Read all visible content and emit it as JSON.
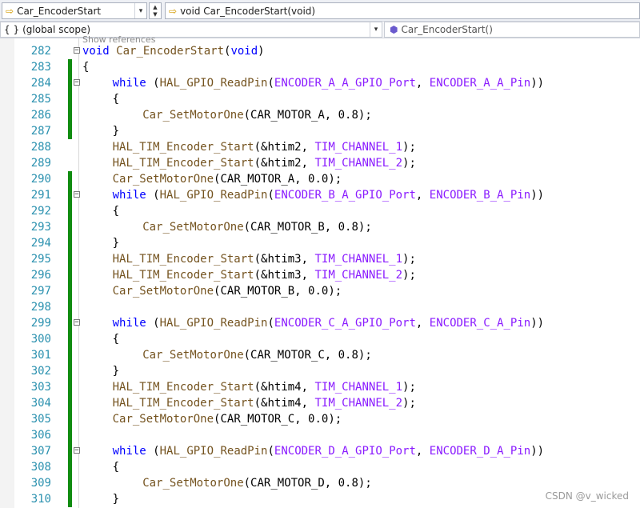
{
  "toolbar": {
    "project_combo": "Car_EncoderStart",
    "member_combo": "void Car_EncoderStart(void)",
    "scope_combo": "(global scope)",
    "scope_icon": "{ }",
    "symbol_combo": "Car_EncoderStart()",
    "spin_up": "▲",
    "spin_down": "▼",
    "dropdown_glyph": "▾"
  },
  "editor": {
    "codelens": "Show references",
    "watermark": "CSDN @v_wicked",
    "colors": {
      "keyword": "#0000ff",
      "function": "#74531f",
      "macro": "#8a1bff",
      "line_number": "#2b91af",
      "change_bar": "#108c10"
    },
    "lines": [
      {
        "num": "282",
        "fold": true,
        "changed": false,
        "indent": 0,
        "tokens": [
          [
            "k",
            "void"
          ],
          [
            "p",
            " "
          ],
          [
            "f",
            "Car_EncoderStart"
          ],
          [
            "p",
            "("
          ],
          [
            "k",
            "void"
          ],
          [
            "p",
            ")"
          ]
        ]
      },
      {
        "num": "283",
        "fold": false,
        "changed": true,
        "indent": 0,
        "tokens": [
          [
            "p",
            "{"
          ]
        ]
      },
      {
        "num": "284",
        "fold": true,
        "changed": true,
        "indent": 1,
        "tokens": [
          [
            "k",
            "while"
          ],
          [
            "p",
            " ("
          ],
          [
            "f",
            "HAL_GPIO_ReadPin"
          ],
          [
            "p",
            "("
          ],
          [
            "m",
            "ENCODER_A_A_GPIO_Port"
          ],
          [
            "p",
            ", "
          ],
          [
            "m",
            "ENCODER_A_A_Pin"
          ],
          [
            "p",
            "))"
          ]
        ]
      },
      {
        "num": "285",
        "fold": false,
        "changed": true,
        "indent": 1,
        "tokens": [
          [
            "p",
            "{"
          ]
        ]
      },
      {
        "num": "286",
        "fold": false,
        "changed": true,
        "indent": 2,
        "tokens": [
          [
            "f",
            "Car_SetMotorOne"
          ],
          [
            "p",
            "(CAR_MOTOR_A, 0.8);"
          ]
        ]
      },
      {
        "num": "287",
        "fold": false,
        "changed": true,
        "indent": 1,
        "tokens": [
          [
            "p",
            "}"
          ]
        ]
      },
      {
        "num": "288",
        "fold": false,
        "changed": false,
        "indent": 1,
        "tokens": [
          [
            "f",
            "HAL_TIM_Encoder_Start"
          ],
          [
            "p",
            "(&htim2, "
          ],
          [
            "m",
            "TIM_CHANNEL_1"
          ],
          [
            "p",
            ");"
          ]
        ]
      },
      {
        "num": "289",
        "fold": false,
        "changed": false,
        "indent": 1,
        "tokens": [
          [
            "f",
            "HAL_TIM_Encoder_Start"
          ],
          [
            "p",
            "(&htim2, "
          ],
          [
            "m",
            "TIM_CHANNEL_2"
          ],
          [
            "p",
            ");"
          ]
        ]
      },
      {
        "num": "290",
        "fold": false,
        "changed": true,
        "indent": 1,
        "tokens": [
          [
            "f",
            "Car_SetMotorOne"
          ],
          [
            "p",
            "(CAR_MOTOR_A, 0.0);"
          ]
        ]
      },
      {
        "num": "291",
        "fold": true,
        "changed": true,
        "indent": 1,
        "tokens": [
          [
            "k",
            "while"
          ],
          [
            "p",
            " ("
          ],
          [
            "f",
            "HAL_GPIO_ReadPin"
          ],
          [
            "p",
            "("
          ],
          [
            "m",
            "ENCODER_B_A_GPIO_Port"
          ],
          [
            "p",
            ", "
          ],
          [
            "m",
            "ENCODER_B_A_Pin"
          ],
          [
            "p",
            "))"
          ]
        ]
      },
      {
        "num": "292",
        "fold": false,
        "changed": true,
        "indent": 1,
        "tokens": [
          [
            "p",
            "{"
          ]
        ]
      },
      {
        "num": "293",
        "fold": false,
        "changed": true,
        "indent": 2,
        "tokens": [
          [
            "f",
            "Car_SetMotorOne"
          ],
          [
            "p",
            "(CAR_MOTOR_B, 0.8);"
          ]
        ]
      },
      {
        "num": "294",
        "fold": false,
        "changed": true,
        "indent": 1,
        "tokens": [
          [
            "p",
            "}"
          ]
        ]
      },
      {
        "num": "295",
        "fold": false,
        "changed": true,
        "indent": 1,
        "tokens": [
          [
            "f",
            "HAL_TIM_Encoder_Start"
          ],
          [
            "p",
            "(&htim3, "
          ],
          [
            "m",
            "TIM_CHANNEL_1"
          ],
          [
            "p",
            ");"
          ]
        ]
      },
      {
        "num": "296",
        "fold": false,
        "changed": true,
        "indent": 1,
        "tokens": [
          [
            "f",
            "HAL_TIM_Encoder_Start"
          ],
          [
            "p",
            "(&htim3, "
          ],
          [
            "m",
            "TIM_CHANNEL_2"
          ],
          [
            "p",
            ");"
          ]
        ]
      },
      {
        "num": "297",
        "fold": false,
        "changed": true,
        "indent": 1,
        "tokens": [
          [
            "f",
            "Car_SetMotorOne"
          ],
          [
            "p",
            "(CAR_MOTOR_B, 0.0);"
          ]
        ]
      },
      {
        "num": "298",
        "fold": false,
        "changed": true,
        "indent": 0,
        "tokens": []
      },
      {
        "num": "299",
        "fold": true,
        "changed": true,
        "indent": 1,
        "tokens": [
          [
            "k",
            "while"
          ],
          [
            "p",
            " ("
          ],
          [
            "f",
            "HAL_GPIO_ReadPin"
          ],
          [
            "p",
            "("
          ],
          [
            "m",
            "ENCODER_C_A_GPIO_Port"
          ],
          [
            "p",
            ", "
          ],
          [
            "m",
            "ENCODER_C_A_Pin"
          ],
          [
            "p",
            "))"
          ]
        ]
      },
      {
        "num": "300",
        "fold": false,
        "changed": true,
        "indent": 1,
        "tokens": [
          [
            "p",
            "{"
          ]
        ]
      },
      {
        "num": "301",
        "fold": false,
        "changed": true,
        "indent": 2,
        "tokens": [
          [
            "f",
            "Car_SetMotorOne"
          ],
          [
            "p",
            "(CAR_MOTOR_C, 0.8);"
          ]
        ]
      },
      {
        "num": "302",
        "fold": false,
        "changed": true,
        "indent": 1,
        "tokens": [
          [
            "p",
            "}"
          ]
        ]
      },
      {
        "num": "303",
        "fold": false,
        "changed": true,
        "indent": 1,
        "tokens": [
          [
            "f",
            "HAL_TIM_Encoder_Start"
          ],
          [
            "p",
            "(&htim4, "
          ],
          [
            "m",
            "TIM_CHANNEL_1"
          ],
          [
            "p",
            ");"
          ]
        ]
      },
      {
        "num": "304",
        "fold": false,
        "changed": true,
        "indent": 1,
        "tokens": [
          [
            "f",
            "HAL_TIM_Encoder_Start"
          ],
          [
            "p",
            "(&htim4, "
          ],
          [
            "m",
            "TIM_CHANNEL_2"
          ],
          [
            "p",
            ");"
          ]
        ]
      },
      {
        "num": "305",
        "fold": false,
        "changed": true,
        "indent": 1,
        "tokens": [
          [
            "f",
            "Car_SetMotorOne"
          ],
          [
            "p",
            "(CAR_MOTOR_C, 0.0);"
          ]
        ]
      },
      {
        "num": "306",
        "fold": false,
        "changed": true,
        "indent": 0,
        "tokens": []
      },
      {
        "num": "307",
        "fold": true,
        "changed": true,
        "indent": 1,
        "tokens": [
          [
            "k",
            "while"
          ],
          [
            "p",
            " ("
          ],
          [
            "f",
            "HAL_GPIO_ReadPin"
          ],
          [
            "p",
            "("
          ],
          [
            "m",
            "ENCODER_D_A_GPIO_Port"
          ],
          [
            "p",
            ", "
          ],
          [
            "m",
            "ENCODER_D_A_Pin"
          ],
          [
            "p",
            "))"
          ]
        ]
      },
      {
        "num": "308",
        "fold": false,
        "changed": true,
        "indent": 1,
        "tokens": [
          [
            "p",
            "{"
          ]
        ]
      },
      {
        "num": "309",
        "fold": false,
        "changed": true,
        "indent": 2,
        "tokens": [
          [
            "f",
            "Car_SetMotorOne"
          ],
          [
            "p",
            "(CAR_MOTOR_D, 0.8);"
          ]
        ]
      },
      {
        "num": "310",
        "fold": false,
        "changed": true,
        "indent": 1,
        "tokens": [
          [
            "p",
            "}"
          ]
        ]
      }
    ]
  }
}
